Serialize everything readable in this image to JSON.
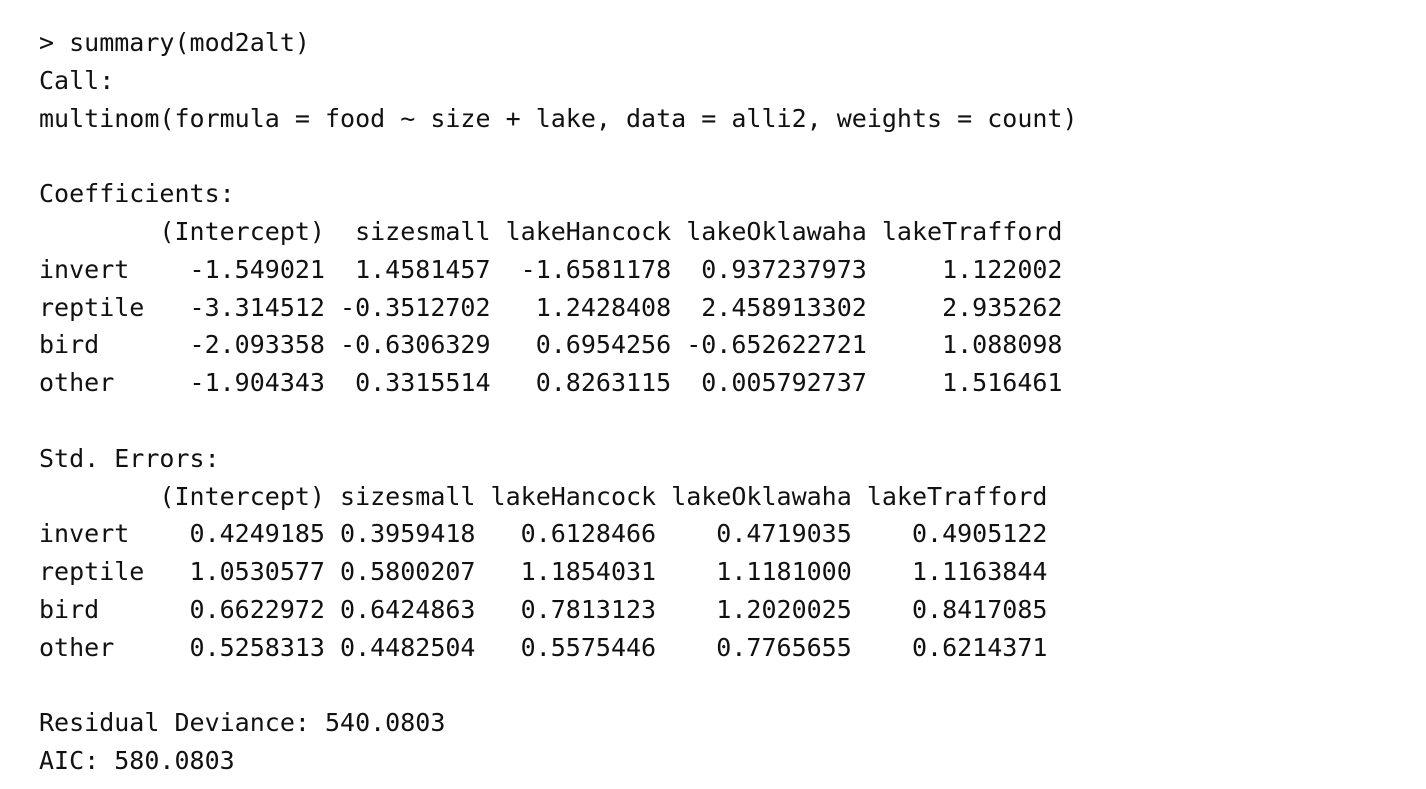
{
  "console": {
    "lines": [
      "> summary(mod2alt)",
      "Call:",
      "multinom(formula = food ~ size + lake, data = alli2, weights = count)",
      "",
      "Coefficients:",
      "        (Intercept)  sizesmall lakeHancock lakeOklawaha lakeTrafford",
      "invert    -1.549021  1.4581457  -1.6581178  0.937237973     1.122002",
      "reptile   -3.314512 -0.3512702   1.2428408  2.458913302     2.935262",
      "bird      -2.093358 -0.6306329   0.6954256 -0.652622721     1.088098",
      "other     -1.904343  0.3315514   0.8263115  0.005792737     1.516461",
      "",
      "Std. Errors:",
      "        (Intercept) sizesmall lakeHancock lakeOklawaha lakeTrafford",
      "invert    0.4249185 0.3959418   0.6128466    0.4719035    0.4905122",
      "reptile   1.0530577 0.5800207   1.1854031    1.1181000    1.1163844",
      "bird      0.6622972 0.6424863   0.7813123    1.2020025    0.8417085",
      "other     0.5258313 0.4482504   0.5575446    0.7765655    0.6214371",
      "",
      "Residual Deviance: 540.0803",
      "AIC: 580.0803"
    ]
  }
}
